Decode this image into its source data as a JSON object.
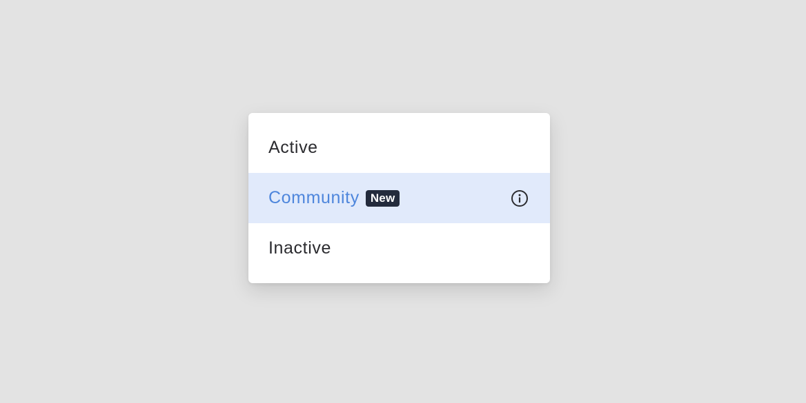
{
  "menu": {
    "items": [
      {
        "label": "Active",
        "selected": false
      },
      {
        "label": "Community",
        "badge": "New",
        "selected": true,
        "icon": "info-icon"
      },
      {
        "label": "Inactive",
        "selected": false
      }
    ]
  },
  "colors": {
    "background": "#e3e3e3",
    "menu_bg": "#ffffff",
    "highlight_bg": "#e1eafb",
    "highlight_text": "#4e86dc",
    "text": "#2b2b2f",
    "badge_bg": "#232b3c",
    "badge_text": "#ffffff"
  }
}
